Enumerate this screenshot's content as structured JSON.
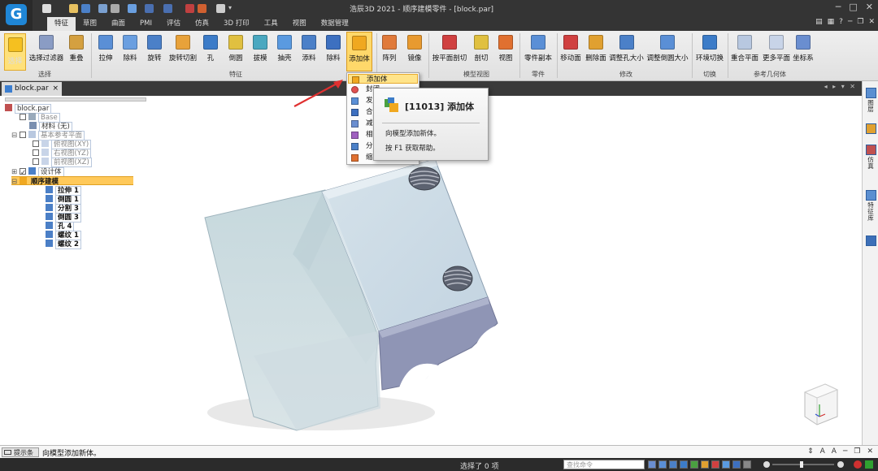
{
  "app": {
    "title": "浩辰3D 2021 - 顺序建模零件 - [block.par]"
  },
  "menu_tabs": [
    "特征",
    "草图",
    "曲面",
    "PMI",
    "评估",
    "仿真",
    "3D 打印",
    "工具",
    "视图",
    "数据管理"
  ],
  "ribbon": {
    "buttons": [
      {
        "label": "选择",
        "color": "#f5c020"
      },
      {
        "label": "选择过滤器",
        "color": "#8a9cc4"
      },
      {
        "label": "重叠",
        "color": "#d4a040"
      },
      {
        "label": "拉伸",
        "color": "#5a8fd6"
      },
      {
        "label": "除料",
        "color": "#6a9fe0"
      },
      {
        "label": "旋转",
        "color": "#4b80c8"
      },
      {
        "label": "旋转切割",
        "color": "#e8a23a"
      },
      {
        "label": "孔",
        "color": "#3c7cc8"
      },
      {
        "label": "倒圆",
        "color": "#e0c040"
      },
      {
        "label": "拔模",
        "color": "#4aa8c0"
      },
      {
        "label": "抽壳",
        "color": "#5a9ae0"
      },
      {
        "label": "添料",
        "color": "#4b80c8"
      },
      {
        "label": "除料",
        "color": "#3d70c0"
      },
      {
        "label": "添加体",
        "color": "#f0a820"
      },
      {
        "label": "阵列",
        "color": "#e07a3a"
      },
      {
        "label": "镜像",
        "color": "#e89a30"
      },
      {
        "label": "按平面剖切",
        "color": "#d04040"
      },
      {
        "label": "剖切",
        "color": "#e0c040"
      },
      {
        "label": "视图",
        "color": "#e07030"
      },
      {
        "label": "零件副本",
        "color": "#5a8fd6"
      },
      {
        "label": "移动面",
        "color": "#d04040"
      },
      {
        "label": "删除面",
        "color": "#e0a030"
      },
      {
        "label": "调整孔大小",
        "color": "#4b80c8"
      },
      {
        "label": "调整倒圆大小",
        "color": "#5a8fd6"
      },
      {
        "label": "环境切换",
        "color": "#3c7cc8"
      },
      {
        "label": "重合平面",
        "color": "#b8c8e0"
      },
      {
        "label": "更多平面",
        "color": "#c8d4e8"
      },
      {
        "label": "坐标系",
        "color": "#6a8ed0"
      }
    ],
    "groups": [
      "选择",
      "特征",
      "模型视图",
      "零件",
      "修改",
      "切换",
      "参考几何体"
    ]
  },
  "document_tab": {
    "label": "block.par",
    "close": "×"
  },
  "right_panel": [
    "图层",
    "仿真",
    "特征库"
  ],
  "tree": {
    "root": "block.par",
    "base": "Base",
    "material": "材料 (无)",
    "ref_planes": "基本参考平面",
    "planes": [
      "俯视图(XY)",
      "右视图(YZ)",
      "前视图(XZ)"
    ],
    "design_body": "设计体",
    "sequential": "顺序建模",
    "features": [
      "拉伸 1",
      "倒圆 1",
      "分割 3",
      "倒圆 3",
      "孔 4",
      "螺纹 1",
      "螺纹 2"
    ]
  },
  "dropdown": {
    "items": [
      "添加体",
      "封闭",
      "发布",
      "合并",
      "减去",
      "相交",
      "分割",
      "缩放"
    ],
    "visible_text": [
      "添加体",
      "封闭",
      "发",
      "合",
      "减",
      "相",
      "分",
      "缩"
    ]
  },
  "tooltip": {
    "title": "[11013] 添加体",
    "description": "向模型添加新体。",
    "help": "按 F1 获取帮助。"
  },
  "status": {
    "prompt_label": "提示条",
    "prompt_text": "向模型添加新体。",
    "selection": "选择了 0 项",
    "command_placeholder": "查找命令"
  },
  "colors": {
    "accent": "#ffd86a",
    "titlebar": "#343434",
    "model_face": "#c9d9e4"
  }
}
